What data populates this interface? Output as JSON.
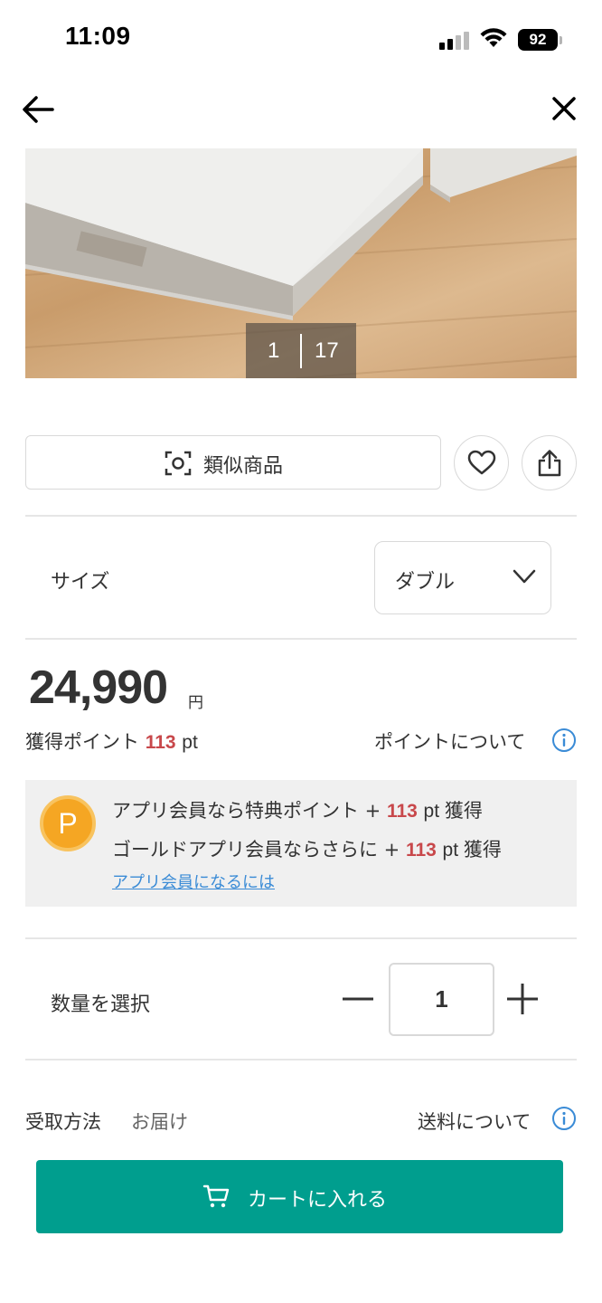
{
  "status_bar": {
    "time": "11:09",
    "battery": "92"
  },
  "product": {
    "image_counter": {
      "current": "1",
      "total": "17"
    },
    "similar_button_label": "類似商品",
    "size": {
      "label": "サイズ",
      "selected": "ダブル"
    },
    "price": {
      "amount": "24,990",
      "unit": "円"
    },
    "points": {
      "label": "獲得ポイント",
      "value": "113",
      "unit": "pt",
      "about_link": "ポイントについて"
    },
    "app_points": {
      "badge": "P",
      "line1": {
        "text": "アプリ会員なら特典ポイント +",
        "value": "113",
        "unit": "pt 獲得"
      },
      "line2": {
        "text": "ゴールドアプリ会員ならさらに +",
        "value": "113",
        "unit": "pt 獲得"
      },
      "link": "アプリ会員になるには"
    },
    "quantity": {
      "label": "数量を選択",
      "value": "1"
    },
    "receive": {
      "label": "受取方法",
      "value": "お届け",
      "shipping_link": "送料について"
    },
    "cart_button_label": "カートに入れる"
  },
  "colors": {
    "accent": "#009e8e",
    "points": "#c8484b",
    "link": "#3a8bd6",
    "badge": "#f5a623"
  },
  "icons": [
    "back-arrow-icon",
    "close-icon",
    "visual-search-icon",
    "heart-icon",
    "share-icon",
    "chevron-down-icon",
    "info-icon",
    "cart-icon",
    "minus-icon",
    "plus-icon"
  ]
}
